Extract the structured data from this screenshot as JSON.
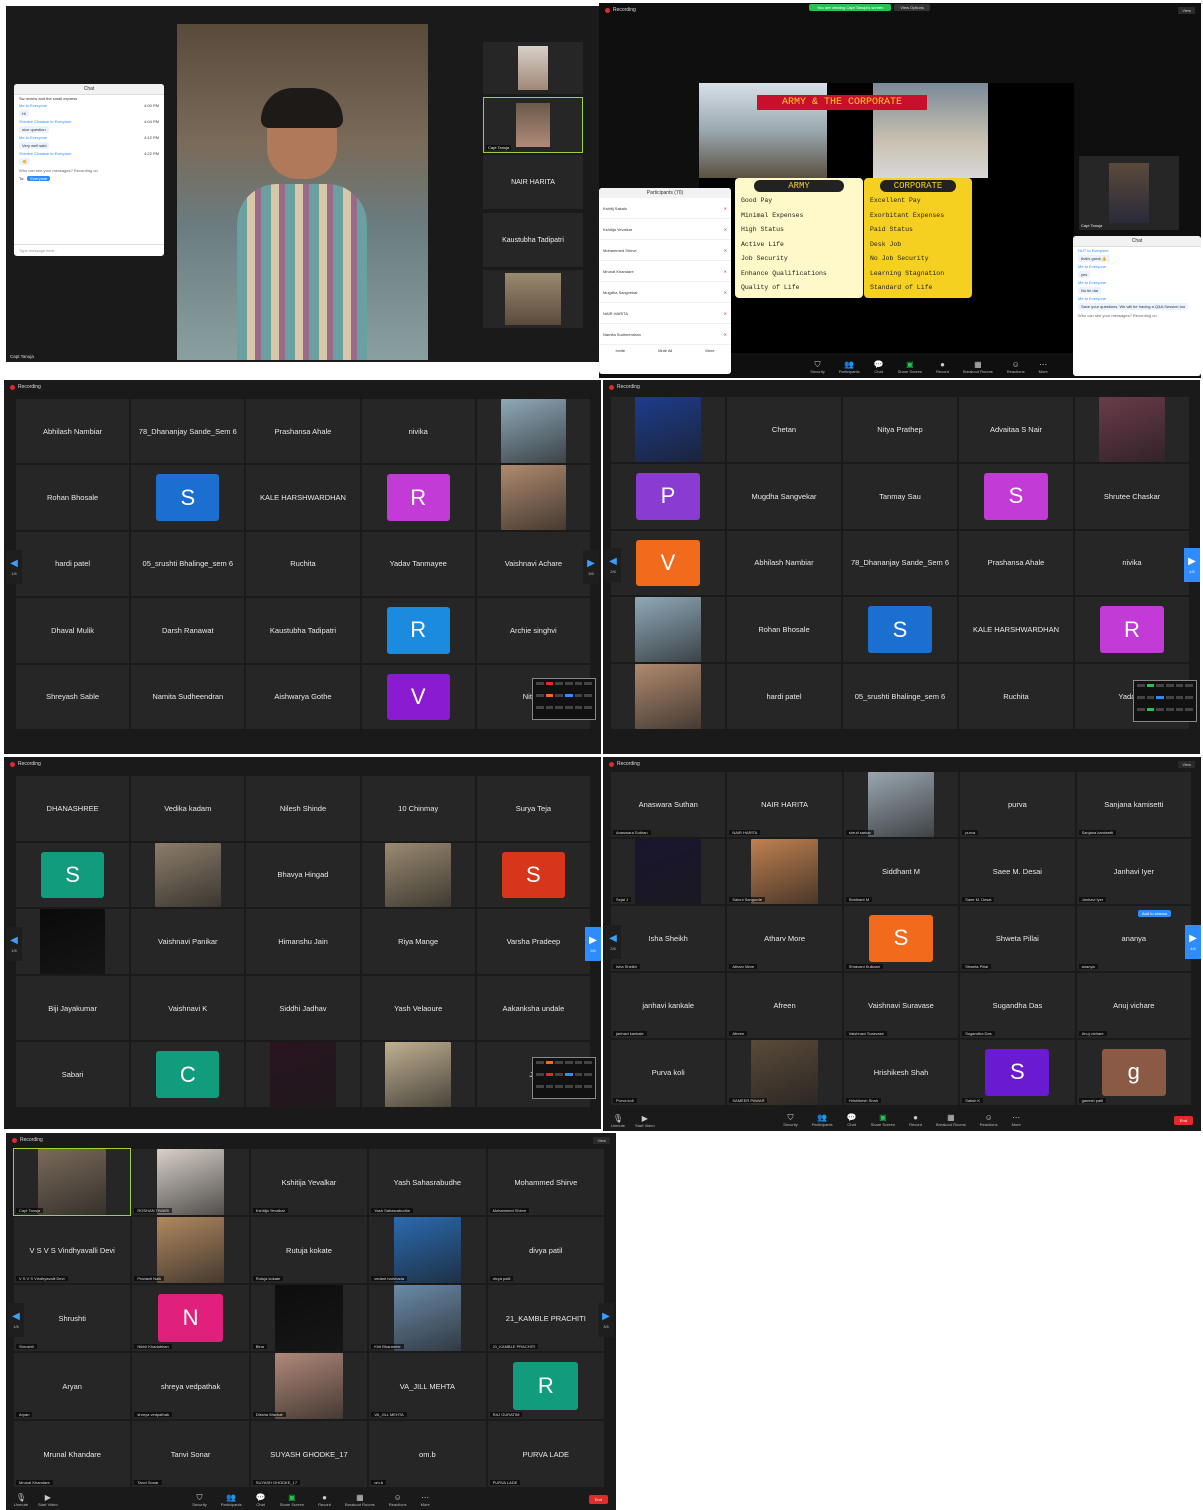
{
  "common": {
    "recording": "Recording",
    "view": "View",
    "end": "End"
  },
  "toolbar": {
    "items": [
      "Security",
      "Participants",
      "Chat",
      "Share Screen",
      "Record",
      "Breakout Rooms",
      "Reactions",
      "More"
    ],
    "left": [
      "Unmute",
      "Start Video"
    ]
  },
  "p1": {
    "speaker_name": "Capt Tanuja",
    "side": [
      "",
      "Capt Tanuja",
      "NAIR HARITA",
      "Kaustubha Tadipatri",
      ""
    ],
    "chat": {
      "title": "Chat",
      "top": "Sw review and the small express",
      "messages": [
        {
          "from": "Me to Everyone",
          "time": "4:00 PM",
          "text": "Hi"
        },
        {
          "from": "Shrutee Chaskar to Everyone",
          "time": "4:04 PM",
          "text": "nice question"
        },
        {
          "from": "Me to Everyone",
          "time": "4:12 PM",
          "text": "Very well said"
        },
        {
          "from": "Shrutee Chaskar to Everyone",
          "time": "4:22 PM",
          "text": "👏"
        }
      ],
      "notice": "Who can see your messages? Recording on",
      "to": "To:",
      "to_value": "Everyone",
      "placeholder": "Type message here..."
    }
  },
  "p2": {
    "banner": "You are viewing Capt Tanuja's screen",
    "banner_btn": "View Options",
    "slide_title": "ARMY & THE CORPORATE",
    "army_header": "ARMY",
    "army_items": [
      "Good Pay",
      "Minimal Expenses",
      "High Status",
      "Active Life",
      "Job Security",
      "Enhance Qualifications",
      "Quality of Life"
    ],
    "corp_header": "CORPORATE",
    "corp_items": [
      "Excellent Pay",
      "Exorbitant Expenses",
      "Paid Status",
      "Desk Job",
      "No Job Security",
      "Learning Stagnation",
      "Standard of Life"
    ],
    "participants_title": "Participants (70)",
    "participants": [
      "Kshitij Sakalo",
      "Kshitija Yevalkar",
      "Mohammed Shirve",
      "Mrunal Khandare",
      "Mugdha Sangvekar",
      "NAIR HARITA",
      "Namita Sudheendran"
    ],
    "plist_buttons": [
      "Invite",
      "Mute All",
      "More"
    ],
    "speaker": "Capt Tanuja",
    "chat": {
      "title": "Chat",
      "messages": [
        {
          "from": "HUT to Everyone",
          "text": "that's great 👍"
        },
        {
          "from": "Me to Everyone",
          "text": "yes"
        },
        {
          "from": "Me to Everyone",
          "text": "No tie dai"
        },
        {
          "from": "Me to Everyone",
          "text": "Save your questions. We will be having a Q&A Session too"
        }
      ],
      "notice": "Who can see your messages? Recording on"
    }
  },
  "p3": {
    "page": "1/6",
    "page_r": "3/6",
    "tiles": [
      {
        "t": "text",
        "v": "Abhilash Nambiar"
      },
      {
        "t": "text",
        "v": "78_Dhananjay Sande_Sem 6"
      },
      {
        "t": "text",
        "v": "Prashansa Ahale"
      },
      {
        "t": "text",
        "v": "nivika"
      },
      {
        "t": "photo",
        "c": "#8fa9b8"
      },
      {
        "t": "text",
        "v": "Rohan Bhosale"
      },
      {
        "t": "av",
        "v": "S",
        "c": "#1b6fd1"
      },
      {
        "t": "text",
        "v": "KALE HARSHWARDHAN"
      },
      {
        "t": "av",
        "v": "R",
        "c": "#c23bd6"
      },
      {
        "t": "photo",
        "c": "#b08a6e"
      },
      {
        "t": "text",
        "v": "hardi patel"
      },
      {
        "t": "text",
        "v": "05_srushti Bhalinge_sem 6"
      },
      {
        "t": "text",
        "v": "Ruchita"
      },
      {
        "t": "text",
        "v": "Yadav Tanmayee"
      },
      {
        "t": "text",
        "v": "Vaishnavi Acharе"
      },
      {
        "t": "text",
        "v": "Dhaval Mulik"
      },
      {
        "t": "text",
        "v": "Darsh Ranawat"
      },
      {
        "t": "text",
        "v": "Kaustubha Tadipatri"
      },
      {
        "t": "av",
        "v": "R",
        "c": "#1b8be0"
      },
      {
        "t": "text",
        "v": "Archie singhvi"
      },
      {
        "t": "text",
        "v": "Shreyash Sable"
      },
      {
        "t": "text",
        "v": "Namita Sudheendran"
      },
      {
        "t": "text",
        "v": "Aishwarya Gothe"
      },
      {
        "t": "av",
        "v": "V",
        "c": "#8a1bd1"
      },
      {
        "t": "text",
        "v": "Nitesh"
      }
    ]
  },
  "p4": {
    "page": "2/6",
    "page_r": "4/6",
    "tiles": [
      {
        "t": "photo",
        "c": "#1c3c8c"
      },
      {
        "t": "text",
        "v": "Chetan"
      },
      {
        "t": "text",
        "v": "Nitya Prathep"
      },
      {
        "t": "text",
        "v": "Advaitaa S Nair"
      },
      {
        "t": "photo",
        "c": "#6b3b4a"
      },
      {
        "t": "av",
        "v": "P",
        "c": "#8a3bd1"
      },
      {
        "t": "text",
        "v": "Mugdha Sangvekar"
      },
      {
        "t": "text",
        "v": "Tanmay Sau"
      },
      {
        "t": "av",
        "v": "S",
        "c": "#c23bd6"
      },
      {
        "t": "text",
        "v": "Shrutee Chaskar"
      },
      {
        "t": "av",
        "v": "V",
        "c": "#f26b1d"
      },
      {
        "t": "text",
        "v": "Abhilash Nambiar"
      },
      {
        "t": "text",
        "v": "78_Dhananjay Sande_Sem 6"
      },
      {
        "t": "text",
        "v": "Prashansa Ahale"
      },
      {
        "t": "text",
        "v": "nivika"
      },
      {
        "t": "photo",
        "c": "#8fa9b8"
      },
      {
        "t": "text",
        "v": "Rohan Bhosale"
      },
      {
        "t": "av",
        "v": "S",
        "c": "#1b6fd1"
      },
      {
        "t": "text",
        "v": "KALE HARSHWARDHAN"
      },
      {
        "t": "av",
        "v": "R",
        "c": "#c23bd6"
      },
      {
        "t": "photo",
        "c": "#b08a6e"
      },
      {
        "t": "text",
        "v": "hardi patel"
      },
      {
        "t": "text",
        "v": "05_srushti Bhalinge_sem 6"
      },
      {
        "t": "text",
        "v": "Ruchita"
      },
      {
        "t": "text",
        "v": "Yadav T"
      }
    ]
  },
  "p5": {
    "page": "1/6",
    "page_r": "3/6",
    "tiles": [
      {
        "t": "text",
        "v": "DHANASHREE"
      },
      {
        "t": "text",
        "v": "Vedika kadam"
      },
      {
        "t": "text",
        "v": "Nilesh Shinde"
      },
      {
        "t": "text",
        "v": "10 Chinmay"
      },
      {
        "t": "text",
        "v": "Surya Teja"
      },
      {
        "t": "av",
        "v": "S",
        "c": "#129c7e"
      },
      {
        "t": "photo",
        "c": "#8c7d6a"
      },
      {
        "t": "text",
        "v": "Bhavya Hingad"
      },
      {
        "t": "photo",
        "c": "#9a8a70"
      },
      {
        "t": "av",
        "v": "S",
        "c": "#d8361b"
      },
      {
        "t": "photo",
        "c": "#0a0a0a"
      },
      {
        "t": "text",
        "v": "Vaishnavi Panikar"
      },
      {
        "t": "text",
        "v": "Himanshu Jain"
      },
      {
        "t": "text",
        "v": "Riya Mange"
      },
      {
        "t": "text",
        "v": "Varsha Pradeep"
      },
      {
        "t": "text",
        "v": "Biji Jayakumar"
      },
      {
        "t": "text",
        "v": "Vaishnavi K"
      },
      {
        "t": "text",
        "v": "Siddhi Jadhav"
      },
      {
        "t": "text",
        "v": "Yash Velaoure"
      },
      {
        "t": "text",
        "v": "Aakanksha undale"
      },
      {
        "t": "text",
        "v": "Sabari"
      },
      {
        "t": "av",
        "v": "C",
        "c": "#129c7e"
      },
      {
        "t": "photo",
        "c": "#2a1420"
      },
      {
        "t": "photo",
        "c": "#c0b090"
      },
      {
        "t": "text",
        "v": "Ju"
      }
    ]
  },
  "p6": {
    "page": "2/6",
    "page_r": "4/6",
    "tiles": [
      {
        "t": "text",
        "v": "Anaswara Suthan",
        "n": "Anaswara Suthan"
      },
      {
        "t": "text",
        "v": "NAIR HARITA",
        "n": "NAIR HARITA"
      },
      {
        "t": "photo",
        "c": "#9aa6b0",
        "n": "shruti sarkar"
      },
      {
        "t": "text",
        "v": "purva",
        "n": "purva"
      },
      {
        "t": "text",
        "v": "Sanjana kamisetti",
        "n": "Sanjana kamisetti"
      },
      {
        "t": "photo",
        "c": "#1a1530",
        "n": "Sejal J"
      },
      {
        "t": "photo",
        "c": "#c08050",
        "n": "Saloni Sangurde"
      },
      {
        "t": "text",
        "v": "Siddhant M",
        "n": "Siddhant M"
      },
      {
        "t": "text",
        "v": "Saee M. Desai",
        "n": "Saee M. Desai"
      },
      {
        "t": "text",
        "v": "Janhavi Iyer",
        "n": "Janhavi Iyer"
      },
      {
        "t": "text",
        "v": "Isha Sheikh",
        "n": "Isha Sheikh"
      },
      {
        "t": "text",
        "v": "Atharv More",
        "n": "Atharv More"
      },
      {
        "t": "av",
        "v": "S",
        "c": "#f26b1d",
        "n": "Shravani Kulkarni"
      },
      {
        "t": "text",
        "v": "Shweta Pillai",
        "n": "Shweta Pillai"
      },
      {
        "t": "text",
        "v": "ananya",
        "n": "ananya"
      },
      {
        "t": "text",
        "v": "janhavi kankale",
        "n": "janhavi kankale"
      },
      {
        "t": "text",
        "v": "Afreen",
        "n": "Afreen"
      },
      {
        "t": "text",
        "v": "Vaishnavi Suravase",
        "n": "Vaishnavi Suravase"
      },
      {
        "t": "text",
        "v": "Sugandha Das",
        "n": "Sugandha Das"
      },
      {
        "t": "text",
        "v": "Anuj vichare",
        "n": "Anuj vichare"
      },
      {
        "t": "text",
        "v": "Purva koli",
        "n": "Purva koli"
      },
      {
        "t": "photo",
        "c": "#5a4a3a",
        "n": "SAMEER PAWAR"
      },
      {
        "t": "text",
        "v": "Hrishikesh Shah",
        "n": "Hrishikesh Shah"
      },
      {
        "t": "av",
        "v": "S",
        "c": "#6a1bd1",
        "n": "Satish K"
      },
      {
        "t": "av",
        "v": "g",
        "c": "#8a5a44",
        "n": "ganesh patil"
      }
    ],
    "add_to_stream": "Add to stream"
  },
  "p7": {
    "page": "1/6",
    "page_r": "3/6",
    "tiles": [
      {
        "t": "photo",
        "c": "#7a6a5a",
        "n": "Capt Tanuja"
      },
      {
        "t": "photo",
        "c": "#d8d0c8",
        "n": "ROSHAN TIWARI"
      },
      {
        "t": "text",
        "v": "Kshitija Yevalkar",
        "n": "Kshitija Yevalkar"
      },
      {
        "t": "text",
        "v": "Yash Sahasrabudhe",
        "n": "Yash Sahasrabudhe"
      },
      {
        "t": "text",
        "v": "Mohammed Shirve",
        "n": "Mohammed Shirve"
      },
      {
        "t": "text",
        "v": "V S V S Vindhyavalli Devi",
        "n": "V S V S Vindhyavalli Devi"
      },
      {
        "t": "photo",
        "c": "#b08860",
        "n": "Pranavti Naik"
      },
      {
        "t": "text",
        "v": "Rutuja kokate",
        "n": "Rutuja kokate"
      },
      {
        "t": "photo",
        "c": "#2a6ab0",
        "n": "vedant harshada"
      },
      {
        "t": "text",
        "v": "divya patil",
        "n": "divya patil"
      },
      {
        "t": "text",
        "v": "Shrushti",
        "n": "Shrushti"
      },
      {
        "t": "av",
        "v": "N",
        "c": "#e0207a",
        "n": "Nikhil Khadabhan"
      },
      {
        "t": "photo",
        "c": "#0d0d0d",
        "n": "Bina"
      },
      {
        "t": "photo",
        "c": "#6a8aa8",
        "n": "Khit Bharambe"
      },
      {
        "t": "text",
        "v": "21_KAMBLE PRACHITI",
        "n": "21_KAMBLE PRACHITI"
      },
      {
        "t": "text",
        "v": "Aryan",
        "n": "Aryan"
      },
      {
        "t": "text",
        "v": "shreya vedpathak",
        "n": "shreya vedpathak"
      },
      {
        "t": "photo",
        "c": "#b08878",
        "n": "Diksha Wachat"
      },
      {
        "t": "text",
        "v": "VA_JILL MEHTA",
        "n": "VA_JILL MEHTA"
      },
      {
        "t": "av",
        "v": "R",
        "c": "#129c7e",
        "n": "RAJ GURATIM"
      },
      {
        "t": "text",
        "v": "Mrunal Khandare",
        "n": "Mrunal Khandare"
      },
      {
        "t": "text",
        "v": "Tanvi Sonar",
        "n": "Tanvi Sonar"
      },
      {
        "t": "text",
        "v": "SUYASH GHODKE_17",
        "n": "SUYASH GHODKE_17"
      },
      {
        "t": "text",
        "v": "om.b",
        "n": "om.b"
      },
      {
        "t": "text",
        "v": "PURVA LADE",
        "n": "PURVA LADE"
      }
    ]
  }
}
